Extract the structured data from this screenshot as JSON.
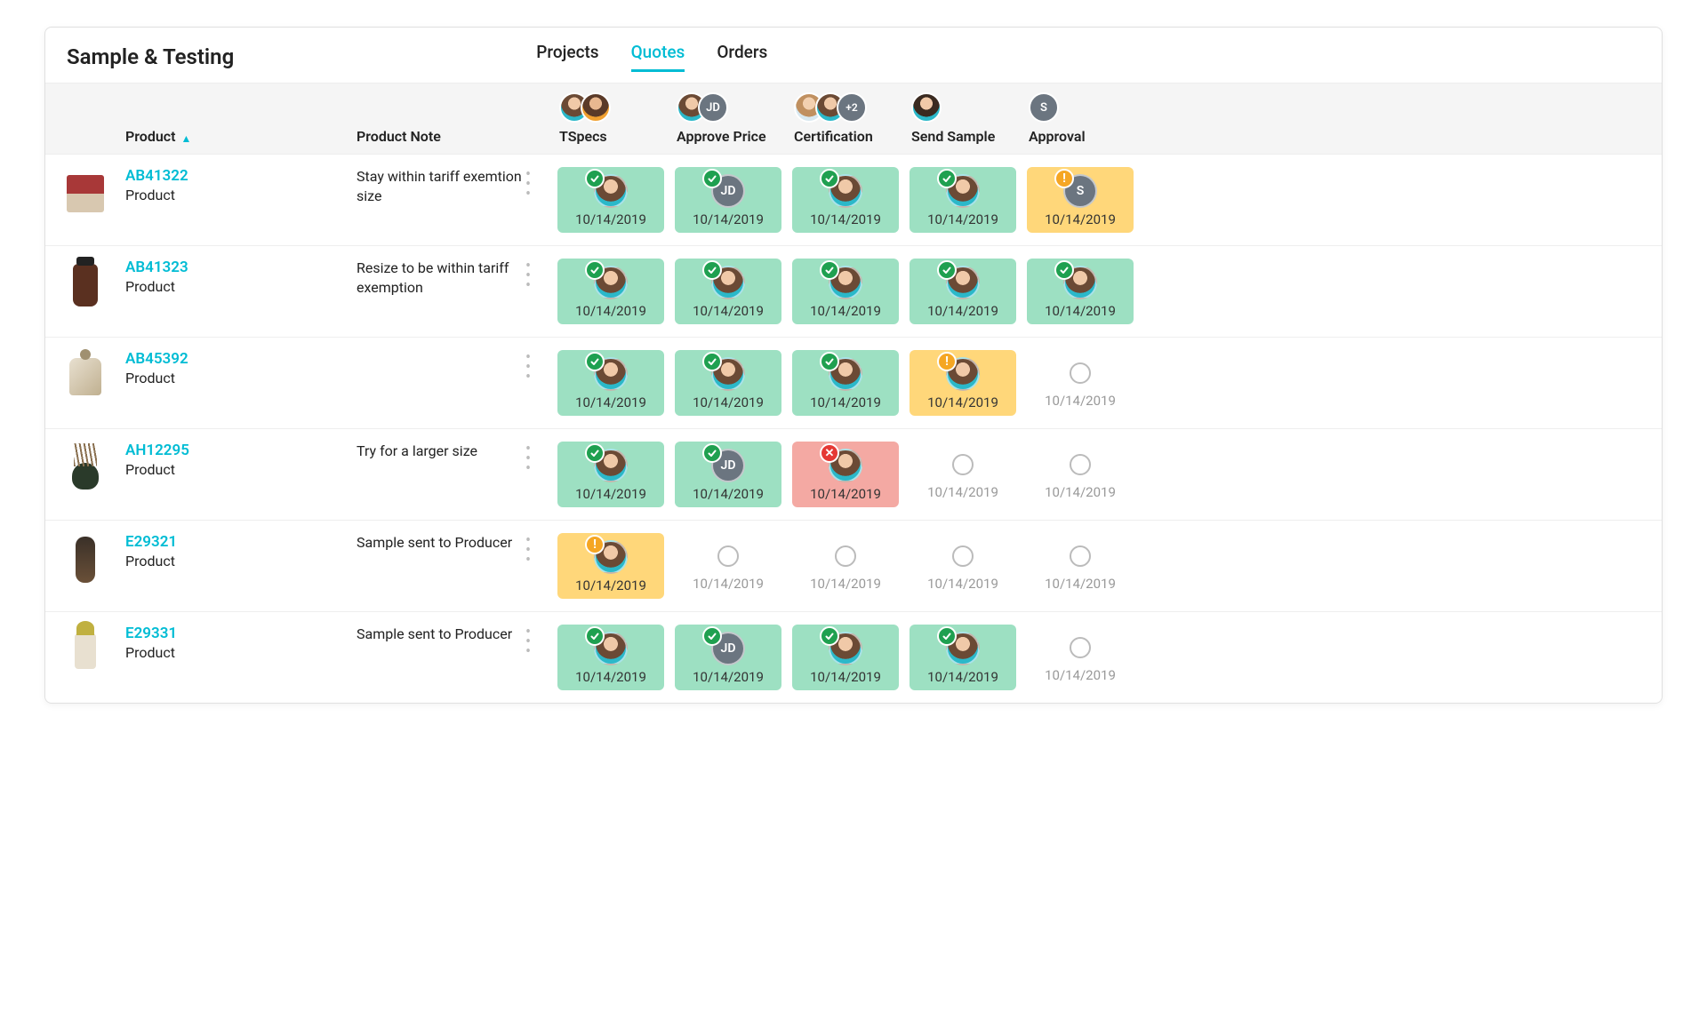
{
  "title": "Sample & Testing",
  "tabs": [
    {
      "label": "Projects",
      "active": false
    },
    {
      "label": "Quotes",
      "active": true
    },
    {
      "label": "Orders",
      "active": false
    }
  ],
  "columns": {
    "product": "Product",
    "note": "Product Note",
    "stages": [
      {
        "key": "tspecs",
        "label": "TSpecs",
        "avatars": [
          {
            "type": "photo1"
          },
          {
            "type": "photo2"
          }
        ]
      },
      {
        "key": "approve_price",
        "label": "Approve Price",
        "avatars": [
          {
            "type": "photo1"
          },
          {
            "type": "initials",
            "text": "JD"
          }
        ]
      },
      {
        "key": "certification",
        "label": "Certification",
        "avatars": [
          {
            "type": "photo3"
          },
          {
            "type": "photo1"
          },
          {
            "type": "count",
            "text": "+2"
          }
        ]
      },
      {
        "key": "send_sample",
        "label": "Send Sample",
        "avatars": [
          {
            "type": "photo4"
          }
        ]
      },
      {
        "key": "approval",
        "label": "Approval",
        "avatars": [
          {
            "type": "initials",
            "text": "S"
          }
        ]
      }
    ]
  },
  "rows": [
    {
      "sku": "AB41322",
      "sub": "Product",
      "note": "Stay within tariff exemtion size",
      "thumb": "pt-candle",
      "cells": [
        {
          "state": "green",
          "badge": "check",
          "avatar": {
            "type": "photo1"
          },
          "date": "10/14/2019"
        },
        {
          "state": "green",
          "badge": "check",
          "avatar": {
            "type": "initials",
            "text": "JD"
          },
          "date": "10/14/2019"
        },
        {
          "state": "green",
          "badge": "check",
          "avatar": {
            "type": "photo1"
          },
          "date": "10/14/2019"
        },
        {
          "state": "green",
          "badge": "check",
          "avatar": {
            "type": "photo1"
          },
          "date": "10/14/2019"
        },
        {
          "state": "yellow",
          "badge": "warn",
          "avatar": {
            "type": "initials",
            "text": "S"
          },
          "date": "10/14/2019"
        }
      ]
    },
    {
      "sku": "AB41323",
      "sub": "Product",
      "note": "Resize to be within tariff exemption",
      "thumb": "pt-jar",
      "cells": [
        {
          "state": "green",
          "badge": "check",
          "avatar": {
            "type": "photo1"
          },
          "date": "10/14/2019"
        },
        {
          "state": "green",
          "badge": "check",
          "avatar": {
            "type": "photo1"
          },
          "date": "10/14/2019"
        },
        {
          "state": "green",
          "badge": "check",
          "avatar": {
            "type": "photo1"
          },
          "date": "10/14/2019"
        },
        {
          "state": "green",
          "badge": "check",
          "avatar": {
            "type": "photo1"
          },
          "date": "10/14/2019"
        },
        {
          "state": "green",
          "badge": "check",
          "avatar": {
            "type": "photo1"
          },
          "date": "10/14/2019"
        }
      ]
    },
    {
      "sku": "AB45392",
      "sub": "Product",
      "note": "",
      "thumb": "pt-bottle",
      "cells": [
        {
          "state": "green",
          "badge": "check",
          "avatar": {
            "type": "photo1"
          },
          "date": "10/14/2019"
        },
        {
          "state": "green",
          "badge": "check",
          "avatar": {
            "type": "photo1"
          },
          "date": "10/14/2019"
        },
        {
          "state": "green",
          "badge": "check",
          "avatar": {
            "type": "photo1"
          },
          "date": "10/14/2019"
        },
        {
          "state": "yellow",
          "badge": "warn",
          "avatar": {
            "type": "photo1"
          },
          "date": "10/14/2019"
        },
        {
          "state": "empty",
          "date": "10/14/2019"
        }
      ]
    },
    {
      "sku": "AH12295",
      "sub": "Product",
      "note": "Try for a larger size",
      "thumb": "pt-diffuser",
      "cells": [
        {
          "state": "green",
          "badge": "check",
          "avatar": {
            "type": "photo1"
          },
          "date": "10/14/2019"
        },
        {
          "state": "green",
          "badge": "check",
          "avatar": {
            "type": "initials",
            "text": "JD"
          },
          "date": "10/14/2019"
        },
        {
          "state": "red",
          "badge": "fail",
          "avatar": {
            "type": "photo1"
          },
          "date": "10/14/2019"
        },
        {
          "state": "empty",
          "date": "10/14/2019"
        },
        {
          "state": "empty",
          "date": "10/14/2019"
        }
      ]
    },
    {
      "sku": "E29321",
      "sub": "Product",
      "note": "Sample sent to Producer",
      "thumb": "pt-spray",
      "cells": [
        {
          "state": "yellow",
          "badge": "warn",
          "avatar": {
            "type": "photo1"
          },
          "date": "10/14/2019"
        },
        {
          "state": "empty",
          "date": "10/14/2019"
        },
        {
          "state": "empty",
          "date": "10/14/2019"
        },
        {
          "state": "empty",
          "date": "10/14/2019"
        },
        {
          "state": "empty",
          "date": "10/14/2019"
        }
      ]
    },
    {
      "sku": "E29331",
      "sub": "Product",
      "note": "Sample sent to Producer",
      "thumb": "pt-mini",
      "cells": [
        {
          "state": "green",
          "badge": "check",
          "avatar": {
            "type": "photo1"
          },
          "date": "10/14/2019"
        },
        {
          "state": "green",
          "badge": "check",
          "avatar": {
            "type": "initials",
            "text": "JD"
          },
          "date": "10/14/2019"
        },
        {
          "state": "green",
          "badge": "check",
          "avatar": {
            "type": "photo1"
          },
          "date": "10/14/2019"
        },
        {
          "state": "green",
          "badge": "check",
          "avatar": {
            "type": "photo1"
          },
          "date": "10/14/2019"
        },
        {
          "state": "empty",
          "date": "10/14/2019"
        }
      ]
    }
  ]
}
